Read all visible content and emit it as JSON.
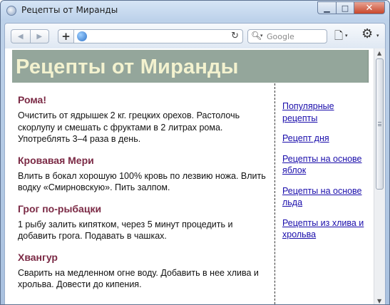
{
  "window": {
    "title": "Рецепты от Миранды"
  },
  "toolbar": {
    "back_glyph": "◀",
    "forward_glyph": "▶",
    "add_glyph": "+",
    "url_value": "",
    "reload_glyph": "↻",
    "search_placeholder": "Google",
    "page_glyph": "🗋",
    "tools_glyph": "⚙",
    "caret_glyph": "▾"
  },
  "page": {
    "header_title": "Рецепты от Миранды",
    "recipes": [
      {
        "title": "Рома!",
        "text": "Очистить от ядрышек 2 кг. грецких орехов. Растолочь скорлупу и смешать с фруктами в 2 литрах рома. Употреблять 3–4 раза в день."
      },
      {
        "title": "Кровавая Мери",
        "text": "Влить в бокал хорошую 100% кровь по лезвию ножа. Влить водку «Смирновскую». Пить залпом."
      },
      {
        "title": "Грог по-рыбацки",
        "text": "1 рыбу залить кипятком, через 5 минут процедить и добавить грога. Подавать в чашках."
      },
      {
        "title": "Хвангур",
        "text": "Сварить на медленном огне воду. Добавить в нее хлива и хрольва. Довести до кипения."
      }
    ],
    "sidebar_links": [
      "Популярные рецепты",
      "Рецепт дня",
      "Рецепты на основе яблок",
      "Рецепты на основе льда",
      "Рецепты из хлива и хрольва"
    ]
  },
  "colors": {
    "header_bg": "#94a69b",
    "header_text": "#f3f2cf",
    "recipe_title": "#7b2a45",
    "link": "#1a0dab"
  }
}
